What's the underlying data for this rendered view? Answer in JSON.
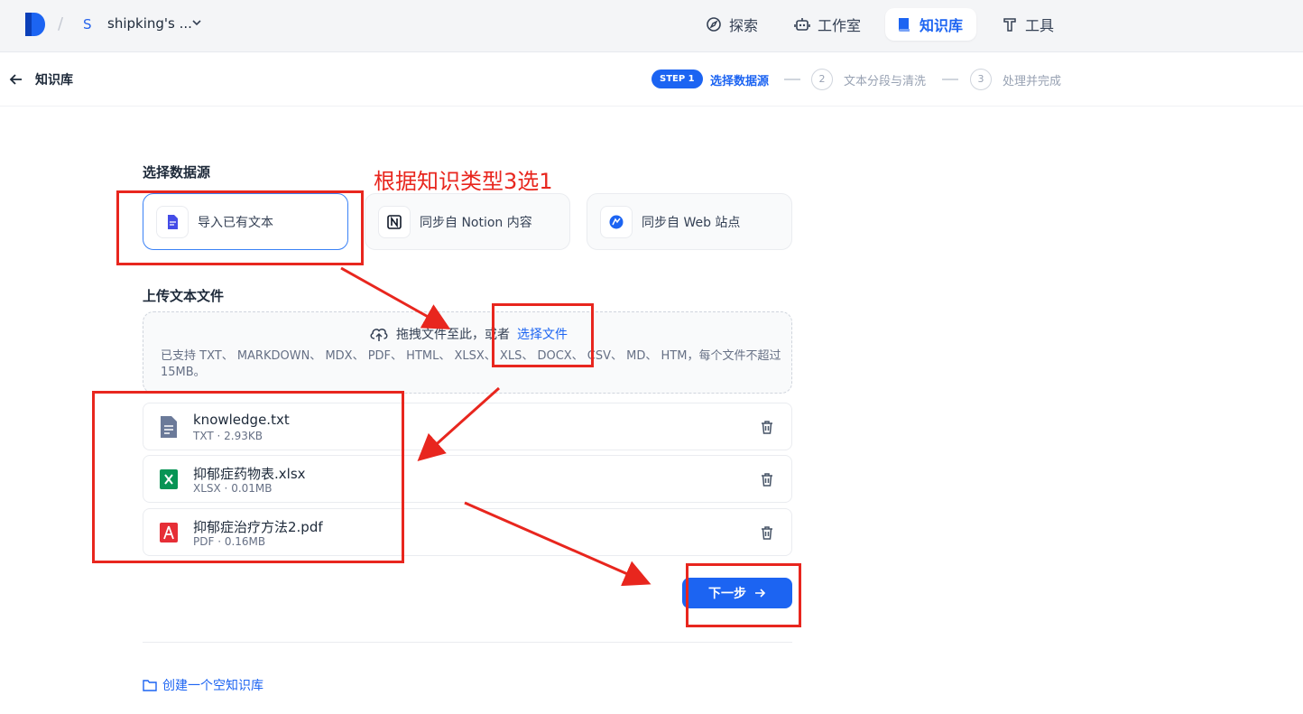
{
  "topbar": {
    "workspace_initial": "S",
    "workspace_name": "shipking's ...",
    "nav": [
      {
        "label": "探索",
        "icon": "compass-icon"
      },
      {
        "label": "工作室",
        "icon": "robot-icon"
      },
      {
        "label": "知识库",
        "icon": "book-icon",
        "active": true
      },
      {
        "label": "工具",
        "icon": "hammer-icon"
      }
    ]
  },
  "header": {
    "title": "知识库",
    "steps": [
      {
        "badge": "STEP 1",
        "label": "选择数据源",
        "active": true
      },
      {
        "number": "2",
        "label": "文本分段与清洗"
      },
      {
        "number": "3",
        "label": "处理并完成"
      }
    ]
  },
  "datasource": {
    "title": "选择数据源",
    "options": [
      {
        "label": "导入已有文本",
        "icon": "document-icon",
        "selected": true
      },
      {
        "label": "同步自 Notion 内容",
        "icon": "notion-icon"
      },
      {
        "label": "同步自 Web 站点",
        "icon": "web-icon"
      }
    ]
  },
  "upload": {
    "title": "上传文本文件",
    "drag_text": "拖拽文件至此，或者",
    "select_link": "选择文件",
    "hint": "已支持 TXT、 MARKDOWN、 MDX、 PDF、 HTML、 XLSX、 XLS、 DOCX、 CSV、 MD、 HTM，每个文件不超过 15MB。"
  },
  "files": [
    {
      "name": "knowledge.txt",
      "meta": "TXT · 2.93KB",
      "type": "txt"
    },
    {
      "name": "抑郁症药物表.xlsx",
      "meta": "XLSX · 0.01MB",
      "type": "xlsx"
    },
    {
      "name": "抑郁症治疗方法2.pdf",
      "meta": "PDF · 0.16MB",
      "type": "pdf"
    }
  ],
  "actions": {
    "next": "下一步",
    "create_empty": "创建一个空知识库"
  },
  "annotation": {
    "note": "根据知识类型3选1",
    "color": "#e8261e"
  },
  "colors": {
    "primary": "#1c64f2",
    "selected_border": "#3b82f6"
  }
}
